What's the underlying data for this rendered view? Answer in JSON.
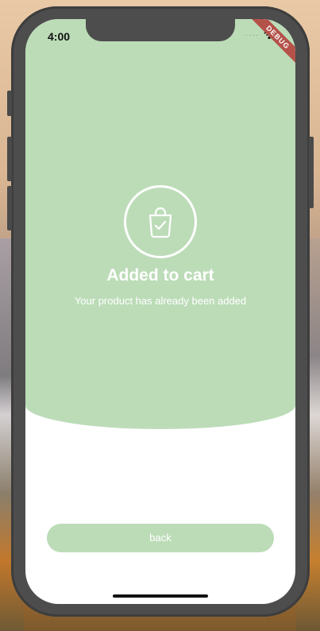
{
  "status_bar": {
    "time": "4:00",
    "signal_icon": "signal-dots-icon",
    "wifi_icon": "wifi-icon"
  },
  "debug_banner": "DEBUG",
  "confirmation": {
    "icon": "shopping-bag-check-icon",
    "title": "Added to cart",
    "subtitle": "Your product has already been added"
  },
  "back_button": {
    "label": "back"
  },
  "colors": {
    "accent": "#bcdcb8",
    "text_on_accent": "#ffffff",
    "background": "#ffffff"
  }
}
